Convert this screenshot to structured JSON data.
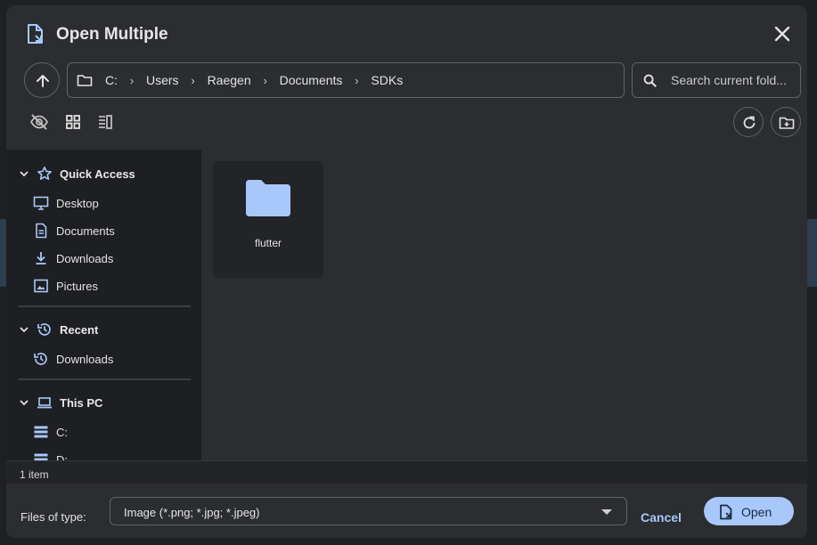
{
  "dialog": {
    "title": "Open Multiple"
  },
  "breadcrumb": [
    "C:",
    "Users",
    "Raegen",
    "Documents",
    "SDKs"
  ],
  "search": {
    "placeholder": "Search current fold..."
  },
  "sidebar": {
    "quick_access": {
      "label": "Quick Access",
      "items": [
        {
          "label": "Desktop",
          "icon": "desktop-icon"
        },
        {
          "label": "Documents",
          "icon": "document-icon"
        },
        {
          "label": "Downloads",
          "icon": "download-icon"
        },
        {
          "label": "Pictures",
          "icon": "image-icon"
        }
      ]
    },
    "recent": {
      "label": "Recent",
      "items": [
        {
          "label": "Downloads",
          "icon": "history-icon"
        }
      ]
    },
    "this_pc": {
      "label": "This PC",
      "items": [
        {
          "label": "C:",
          "icon": "drive-icon"
        },
        {
          "label": "D:",
          "icon": "drive-icon"
        }
      ]
    }
  },
  "content": {
    "items": [
      {
        "name": "flutter",
        "type": "folder"
      }
    ]
  },
  "status": {
    "count": "1 item"
  },
  "footer": {
    "files_of_type_label": "Files of type:",
    "file_type_value": "Image (*.png; *.jpg; *.jpeg)",
    "cancel_label": "Cancel",
    "open_label": "Open"
  },
  "colors": {
    "accent": "#a8c7fa",
    "dialog_bg": "#2b2d30",
    "sidebar_bg": "#1e1f22",
    "folder": "#a8c7fa"
  }
}
